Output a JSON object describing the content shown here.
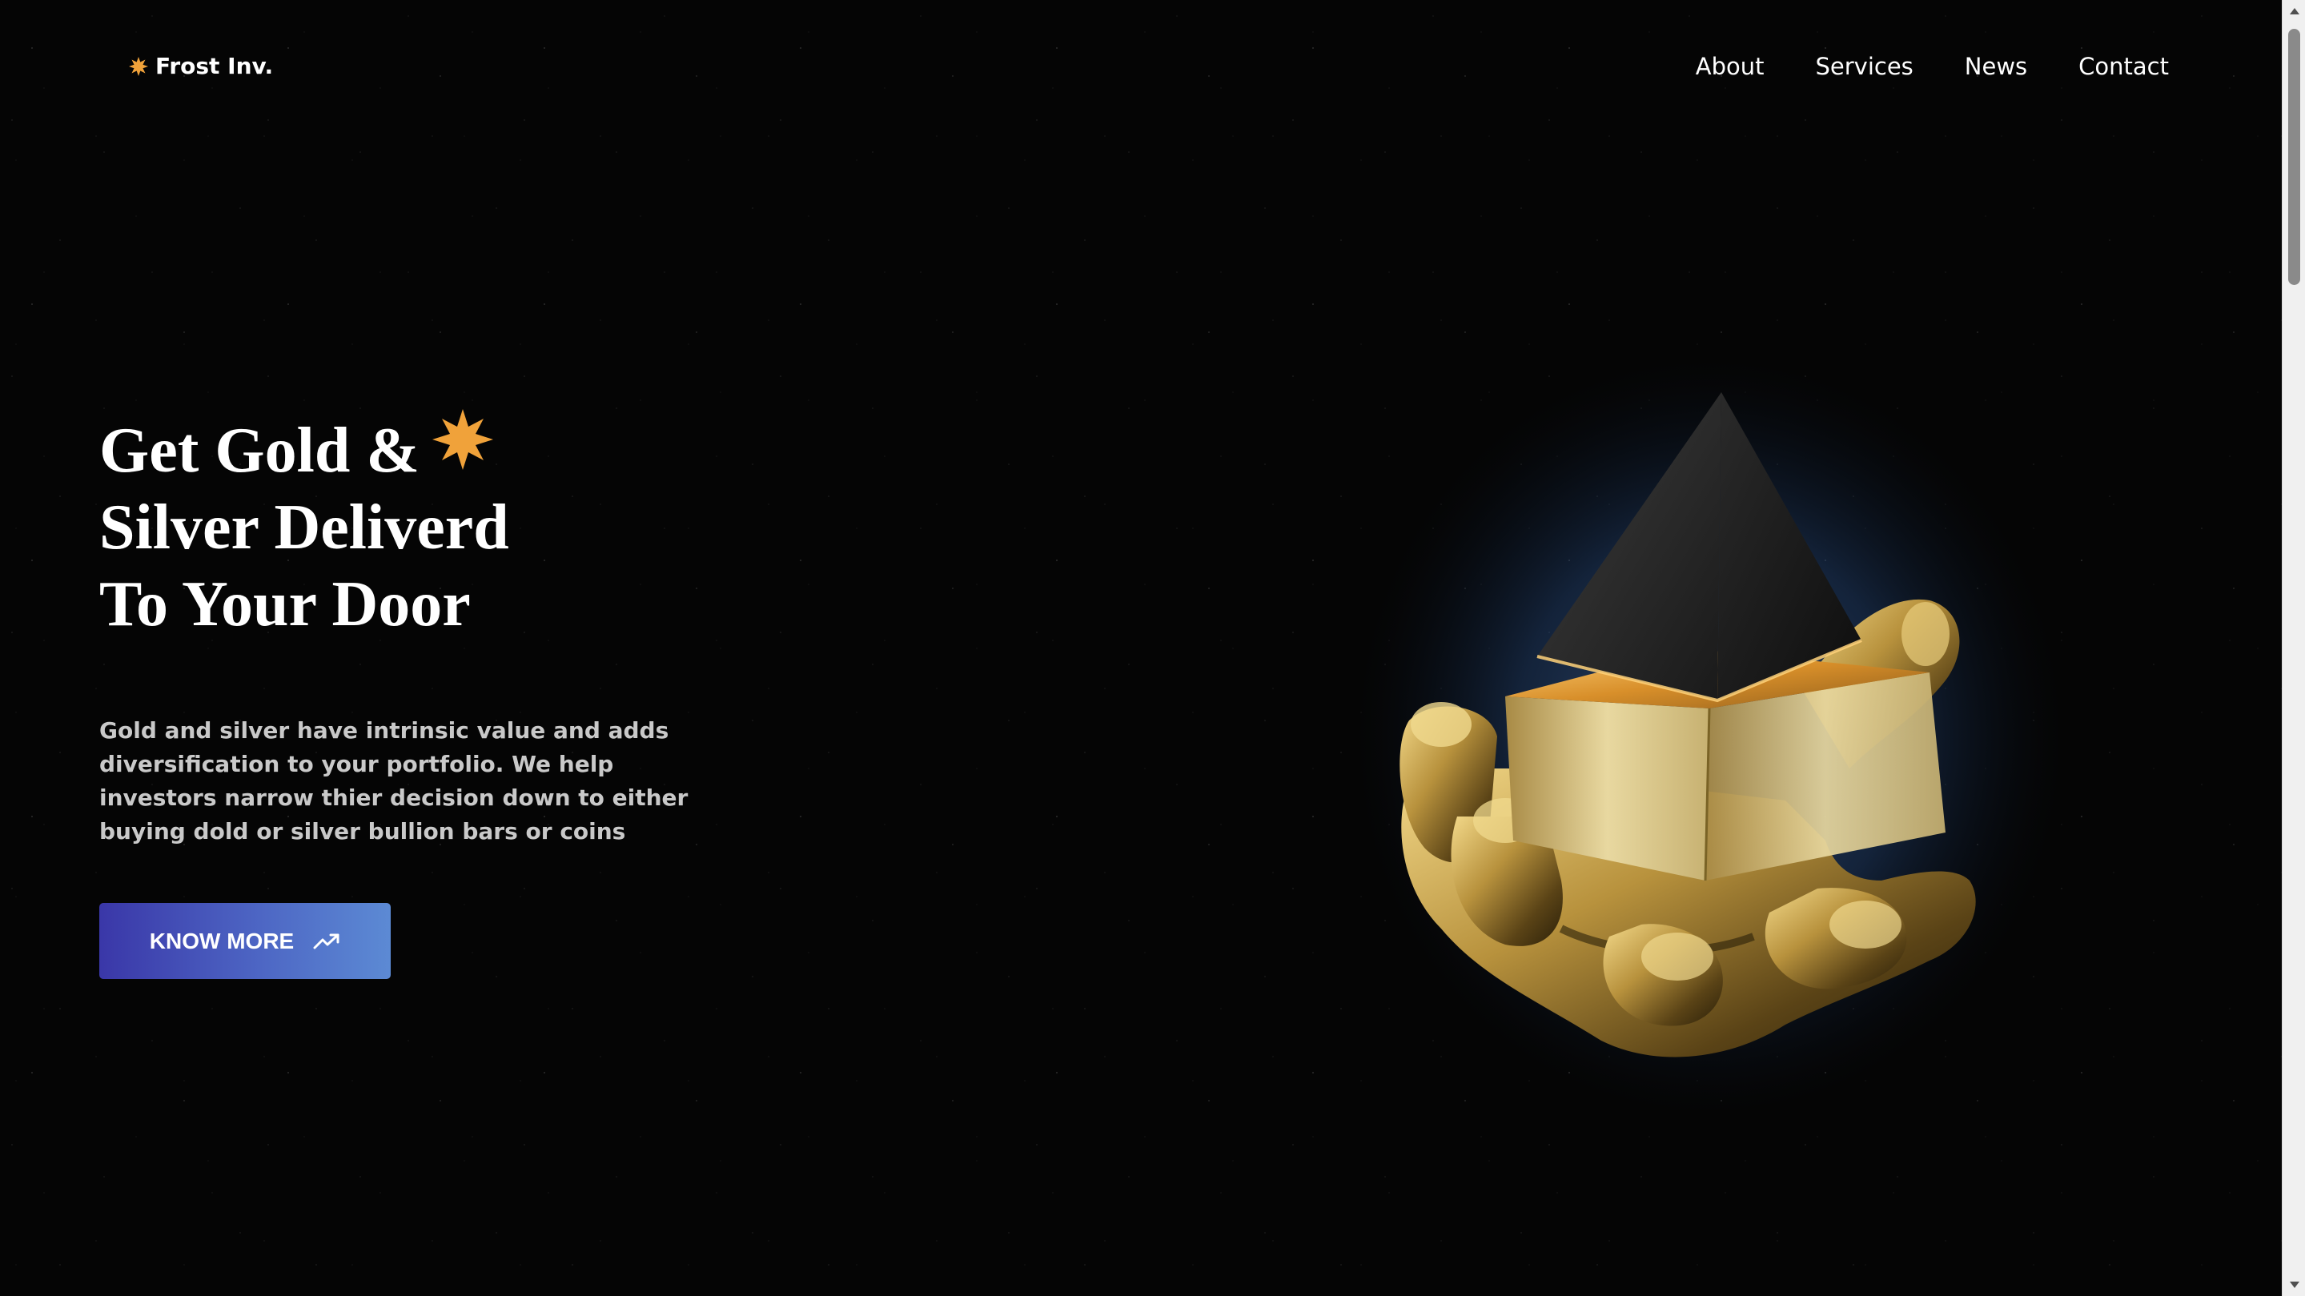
{
  "brand": {
    "name": "Frost Inv.",
    "icon": "star-burst-icon",
    "accent_color": "#f0a23a"
  },
  "nav": {
    "items": [
      {
        "label": "About"
      },
      {
        "label": "Services"
      },
      {
        "label": "News"
      },
      {
        "label": "Contact"
      }
    ]
  },
  "hero": {
    "title_lines": [
      "Get Gold &",
      "Silver Deliverd",
      "To Your Door"
    ],
    "title_icon": "star-burst-icon",
    "description": "Gold and silver have intrinsic value and adds diversification to your portfolio. We help investors narrow thier decision down to either buying dold or silver bullion bars or coins",
    "cta": {
      "label": "KNOW MORE",
      "icon": "trending-up-icon",
      "gradient_start": "#3a37a8",
      "gradient_end": "#5c8ad4"
    }
  },
  "artwork": {
    "icon": "golden-hand-pyramid-image"
  },
  "theme": {
    "background": "#050505",
    "text_primary": "#ffffff",
    "text_secondary": "#c9c9c9"
  }
}
